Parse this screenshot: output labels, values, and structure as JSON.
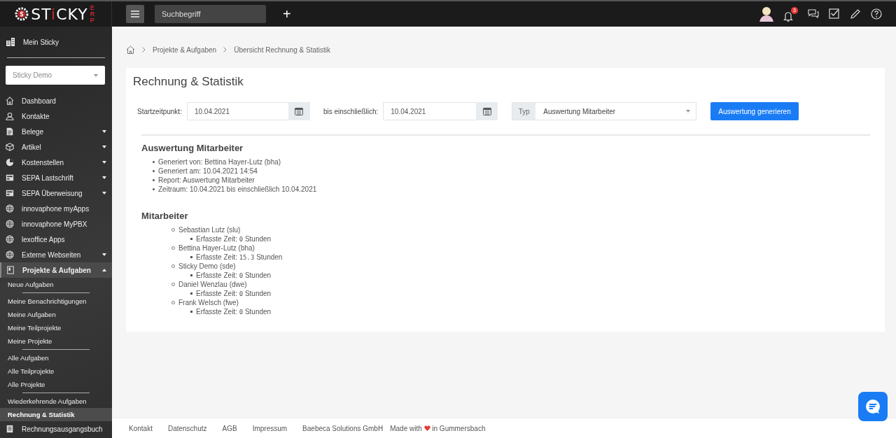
{
  "logo": {
    "parts": [
      {
        "text": "ST",
        "accent": false
      },
      {
        "text": "i",
        "accent": true
      },
      {
        "text": "CKY",
        "accent": false
      }
    ],
    "suffix": "ERP"
  },
  "topbar": {
    "search": {
      "placeholder": "Suchbegriff"
    },
    "add_button": "+",
    "notifications": {
      "badge": "3"
    }
  },
  "sidebar": {
    "home_item": "Mein Sticky",
    "company_select": {
      "value": "Sticky Demo"
    },
    "items": [
      {
        "label": "Dashboard",
        "kind": "home",
        "has_submenu": false,
        "expanded": false
      },
      {
        "label": "Kontakte",
        "kind": "people",
        "has_submenu": false,
        "expanded": false
      },
      {
        "label": "Belege",
        "kind": "document",
        "has_submenu": true,
        "expanded": false
      },
      {
        "label": "Artikel",
        "kind": "box",
        "has_submenu": true,
        "expanded": false
      },
      {
        "label": "Kostenstellen",
        "kind": "pie",
        "has_submenu": true,
        "expanded": false
      },
      {
        "label": "SEPA Lastschrift",
        "kind": "card",
        "has_submenu": true,
        "expanded": false
      },
      {
        "label": "SEPA Überweisung",
        "kind": "card",
        "has_submenu": true,
        "expanded": false
      },
      {
        "label": "innovaphone myApps",
        "kind": "globe",
        "has_submenu": false,
        "expanded": false
      },
      {
        "label": "innovaphone MyPBX",
        "kind": "globe",
        "has_submenu": false,
        "expanded": false
      },
      {
        "label": "lexoffice Apps",
        "kind": "globe",
        "has_submenu": false,
        "expanded": false
      },
      {
        "label": "Externe Webseiten",
        "kind": "globe",
        "has_submenu": true,
        "expanded": false
      },
      {
        "label": "Projekte & Aufgaben",
        "kind": "book",
        "has_submenu": true,
        "expanded": true,
        "children": [
          [
            {
              "label": "Neue Aufgaben",
              "selected": false
            }
          ],
          [
            {
              "label": "Meine Benachrichtigungen",
              "selected": false
            },
            {
              "label": "Meine Aufgaben",
              "selected": false
            },
            {
              "label": "Meine Teilprojekte",
              "selected": false
            },
            {
              "label": "Meine Projekte",
              "selected": false
            }
          ],
          [
            {
              "label": "Alle Aufgaben",
              "selected": false
            },
            {
              "label": "Alle Teilprojekte",
              "selected": false
            },
            {
              "label": "Alle Projekte",
              "selected": false
            }
          ],
          [
            {
              "label": "Wiederkehrende Aufgaben",
              "selected": false
            },
            {
              "label": "Rechnung & Statistik",
              "selected": true
            }
          ]
        ]
      },
      {
        "label": "Rechnungsausgangsbuch",
        "kind": "ledger",
        "has_submenu": false,
        "expanded": false
      }
    ]
  },
  "breadcrumb": [
    "Projekte & Aufgaben",
    "Übersicht Rechnung & Statistik"
  ],
  "card": {
    "title": "Rechnung & Statistik",
    "form": {
      "start_label": "Startzeitpunkt:",
      "start_value": "10.04.2021",
      "end_label": "bis einschließlich:",
      "end_value": "10.04.2021",
      "type_label": "Typ",
      "type_value": "Auswertung Mitarbeiter",
      "submit": "Auswertung generieren"
    },
    "report": {
      "title": "Auswertung Mitarbeiter",
      "details": [
        "Generiert von: Bettina Hayer-Lutz (bha)",
        "Generiert am: 10.04.2021 14:54",
        "Report: Auswertung Mitarbeiter",
        "Zeitraum: 10.04.2021 bis einschließlich 10.04.2021"
      ],
      "employees_title": "Mitarbeiter",
      "employees": [
        {
          "name": "Sebastian Lutz (slu)",
          "time_label": "Erfasste Zeit:",
          "hours": "0",
          "unit": "Stunden"
        },
        {
          "name": "Bettina Hayer-Lutz (bha)",
          "time_label": "Erfasste Zeit:",
          "hours": "15.3",
          "unit": "Stunden"
        },
        {
          "name": "Sticky Demo (sde)",
          "time_label": "Erfasste Zeit:",
          "hours": "0",
          "unit": "Stunden"
        },
        {
          "name": "Daniel Wenzlau (dwe)",
          "time_label": "Erfasste Zeit:",
          "hours": "0",
          "unit": "Stunden"
        },
        {
          "name": "Frank Welsch (fwe)",
          "time_label": "Erfasste Zeit:",
          "hours": "0",
          "unit": "Stunden"
        }
      ]
    }
  },
  "footer": {
    "links": [
      "Kontakt",
      "Datenschutz",
      "AGB",
      "Impressum",
      "Baebeca Solutions GmbH"
    ],
    "credit_before": "Made with",
    "credit_after": "in Gummersbach"
  }
}
